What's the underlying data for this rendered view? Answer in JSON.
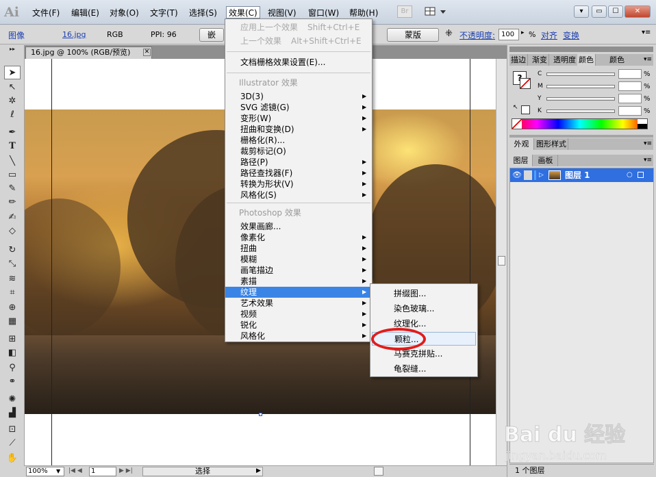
{
  "app": {
    "logo": "Ai"
  },
  "menubar": {
    "items": [
      "文件(F)",
      "编辑(E)",
      "对象(O)",
      "文字(T)",
      "选择(S)",
      "效果(C)",
      "视图(V)",
      "窗口(W)",
      "帮助(H)"
    ],
    "bridge_button": "Br",
    "window_controls": [
      "▾",
      "▭",
      "☐",
      "✕"
    ]
  },
  "controlbar": {
    "object_type": "图像",
    "file_link": "16.jpg",
    "color_mode": "RGB",
    "ppi": "PPI: 96",
    "embed_button": "嵌",
    "mask_button": "蒙版",
    "opacity_label": "不透明度:",
    "opacity_value": "100",
    "opacity_unit": "%",
    "align_link": "对齐",
    "transform_link": "变换"
  },
  "document": {
    "tab_title": "16.jpg @ 100% (RGB/预览)",
    "tab_close": "✕"
  },
  "statusbar": {
    "zoom": "100%",
    "artboard": "1",
    "tool_name": "选择"
  },
  "effect_menu": {
    "apply_last": "应用上一个效果",
    "apply_last_shortcut": "Shift+Ctrl+E",
    "last_effect": "上一个效果",
    "last_effect_shortcut": "Alt+Shift+Ctrl+E",
    "raster_settings": "文档栅格效果设置(E)...",
    "illustrator_header": "Illustrator 效果",
    "illustrator_items": [
      "3D(3)",
      "SVG 滤镜(G)",
      "变形(W)",
      "扭曲和变换(D)",
      "栅格化(R)...",
      "裁剪标记(O)",
      "路径(P)",
      "路径查找器(F)",
      "转换为形状(V)",
      "风格化(S)"
    ],
    "photoshop_header": "Photoshop 效果",
    "photoshop_items": [
      "效果画廊...",
      "像素化",
      "扭曲",
      "模糊",
      "画笔描边",
      "素描",
      "纹理",
      "艺术效果",
      "视频",
      "锐化",
      "风格化"
    ]
  },
  "texture_submenu": {
    "items": [
      "拼缀图...",
      "染色玻璃...",
      "纹理化...",
      "颗粒...",
      "马赛克拼贴...",
      "龟裂缝..."
    ]
  },
  "panels": {
    "color_tabs": [
      "描边",
      "渐变",
      "透明度",
      "颜色"
    ],
    "cmyk_labels": [
      "C",
      "M",
      "Y",
      "K"
    ],
    "percent": "%",
    "appearance_tabs": [
      "外观",
      "图形样式"
    ],
    "layers_tabs": [
      "图层",
      "画板"
    ],
    "layer_name": "图层 1",
    "layers_footer": "1 个图层"
  },
  "watermark": {
    "brand": "Bai du 经验",
    "url": "jingyan.baidu.com"
  },
  "colors": {
    "menu_highlight": "#3a84e6",
    "layer_selected": "#2f6fe0",
    "annotation_circle": "#e21b1b"
  }
}
